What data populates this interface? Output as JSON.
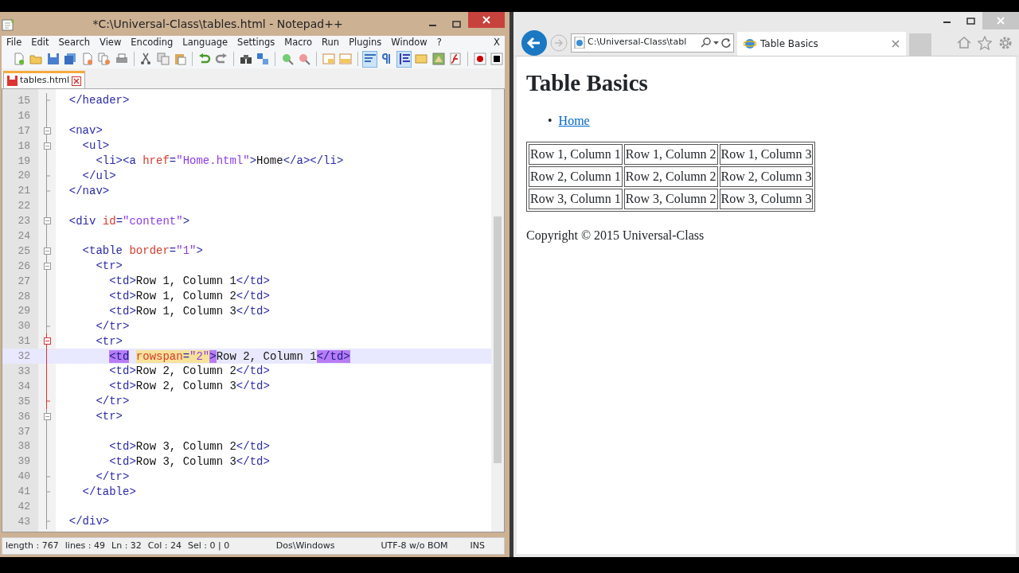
{
  "editor_window": {
    "title": "*C:\\Universal-Class\\tables.html - Notepad++",
    "menu": [
      "File",
      "Edit",
      "Search",
      "View",
      "Encoding",
      "Language",
      "Settings",
      "Macro",
      "Run",
      "Plugins",
      "Window",
      "?"
    ],
    "menu_close": "X",
    "toolbar": [
      {
        "kind": "new"
      },
      {
        "kind": "open"
      },
      {
        "kind": "save"
      },
      {
        "kind": "saveall"
      },
      {
        "kind": "close"
      },
      {
        "kind": "closeall"
      },
      {
        "kind": "print"
      },
      {
        "kind": "separator"
      },
      {
        "kind": "cut"
      },
      {
        "kind": "copy"
      },
      {
        "kind": "paste"
      },
      {
        "kind": "separator"
      },
      {
        "kind": "undo"
      },
      {
        "kind": "redo"
      },
      {
        "kind": "separator"
      },
      {
        "kind": "find"
      },
      {
        "kind": "replace"
      },
      {
        "kind": "separator"
      },
      {
        "kind": "zoomin"
      },
      {
        "kind": "zoomout"
      },
      {
        "kind": "separator"
      },
      {
        "kind": "syncv"
      },
      {
        "kind": "synch"
      },
      {
        "kind": "separator"
      },
      {
        "kind": "wrap",
        "pressed": true
      },
      {
        "kind": "allchars",
        "pressed": false
      },
      {
        "kind": "indent",
        "pressed": true
      },
      {
        "kind": "udl",
        "pressed": false
      },
      {
        "kind": "docmap",
        "pressed": false
      },
      {
        "kind": "funclist",
        "pressed": false
      },
      {
        "kind": "separator"
      },
      {
        "kind": "record"
      },
      {
        "kind": "stop"
      }
    ],
    "tabs": [
      {
        "label": "tables.html",
        "selected": true
      }
    ],
    "lines": [
      {
        "number": "15",
        "kind": "fold_end",
        "text": [
          {
            "kind": "tag",
            "text": "  </header>"
          }
        ]
      },
      {
        "number": "16",
        "kind": "plain"
      },
      {
        "number": "17",
        "kind": "fold_open",
        "text": [
          {
            "kind": "tag",
            "text": "  <nav>"
          }
        ]
      },
      {
        "number": "18",
        "kind": "fold_open",
        "text": [
          {
            "kind": "tag",
            "text": "    <ul>"
          }
        ]
      },
      {
        "number": "19",
        "kind": "plain",
        "text": [
          {
            "kind": "tag",
            "text": "      <li><a "
          },
          {
            "kind": "attr",
            "text": "href"
          },
          {
            "kind": "tag",
            "text": "="
          },
          {
            "kind": "value",
            "text": "\"Home.html\""
          },
          {
            "kind": "tag",
            "text": ">"
          },
          {
            "kind": "plain",
            "text": "Home"
          },
          {
            "kind": "tag",
            "text": "</a></li>"
          }
        ]
      },
      {
        "number": "20",
        "kind": "fold_end",
        "text": [
          {
            "kind": "tag",
            "text": "    </ul>"
          }
        ]
      },
      {
        "number": "21",
        "kind": "fold_end",
        "text": [
          {
            "kind": "tag",
            "text": "  </nav>"
          }
        ]
      },
      {
        "number": "22",
        "kind": "plain"
      },
      {
        "number": "23",
        "kind": "fold_open",
        "text": [
          {
            "kind": "tag",
            "text": "  <div "
          },
          {
            "kind": "attr",
            "text": "id"
          },
          {
            "kind": "tag",
            "text": "="
          },
          {
            "kind": "value",
            "text": "\"content\""
          },
          {
            "kind": "tag",
            "text": ">"
          }
        ]
      },
      {
        "number": "24",
        "kind": "plain"
      },
      {
        "number": "25",
        "kind": "fold_open",
        "text": [
          {
            "kind": "tag",
            "text": "    <table "
          },
          {
            "kind": "attr",
            "text": "border"
          },
          {
            "kind": "tag",
            "text": "="
          },
          {
            "kind": "value",
            "text": "\"1\""
          },
          {
            "kind": "tag",
            "text": ">"
          }
        ]
      },
      {
        "number": "26",
        "kind": "fold_open",
        "text": [
          {
            "kind": "tag",
            "text": "      <tr>"
          }
        ]
      },
      {
        "number": "27",
        "kind": "plain",
        "text": [
          {
            "kind": "tag",
            "text": "        <td>"
          },
          {
            "kind": "plain",
            "text": "Row 1, Column 1"
          },
          {
            "kind": "tag",
            "text": "</td>"
          }
        ]
      },
      {
        "number": "28",
        "kind": "plain",
        "text": [
          {
            "kind": "tag",
            "text": "        <td>"
          },
          {
            "kind": "plain",
            "text": "Row 1, Column 2"
          },
          {
            "kind": "tag",
            "text": "</td>"
          }
        ]
      },
      {
        "number": "29",
        "kind": "plain",
        "text": [
          {
            "kind": "tag",
            "text": "        <td>"
          },
          {
            "kind": "plain",
            "text": "Row 1, Column 3"
          },
          {
            "kind": "tag",
            "text": "</td>"
          }
        ]
      },
      {
        "number": "30",
        "kind": "fold_end",
        "text": [
          {
            "kind": "tag",
            "text": "      </tr>"
          }
        ]
      },
      {
        "number": "31",
        "kind": "fold_open",
        "current_block": true,
        "text": [
          {
            "kind": "tag",
            "text": "      <tr>"
          }
        ]
      },
      {
        "number": "32",
        "kind": "plain",
        "current_block": true,
        "selected": true,
        "text": [
          {
            "kind": "tag",
            "text": "        <td",
            "brace_match": true
          },
          {
            "kind": "attr",
            "text": " rowspan",
            "smart_highlight": true
          },
          {
            "kind": "tag",
            "text": "=",
            "smart_highlight": true
          },
          {
            "kind": "value",
            "text": "\"2\"",
            "smart_highlight": true
          },
          {
            "kind": "tag",
            "text": ">",
            "brace_match": true
          },
          {
            "kind": "plain",
            "text": "Row 2, Column 1"
          },
          {
            "kind": "tag",
            "text": "</td>",
            "brace_match": true
          }
        ]
      },
      {
        "number": "33",
        "kind": "plain",
        "current_block": true,
        "text": [
          {
            "kind": "tag",
            "text": "        <td>"
          },
          {
            "kind": "plain",
            "text": "Row 2, Column 2"
          },
          {
            "kind": "tag",
            "text": "</td>"
          }
        ]
      },
      {
        "number": "34",
        "kind": "plain",
        "current_block": true,
        "text": [
          {
            "kind": "tag",
            "text": "        <td>"
          },
          {
            "kind": "plain",
            "text": "Row 2, Column 3"
          },
          {
            "kind": "tag",
            "text": "</td>"
          }
        ]
      },
      {
        "number": "35",
        "kind": "fold_end",
        "current_block": true,
        "text": [
          {
            "kind": "tag",
            "text": "      </tr>"
          }
        ]
      },
      {
        "number": "36",
        "kind": "fold_open",
        "text": [
          {
            "kind": "tag",
            "text": "      <tr>"
          }
        ]
      },
      {
        "number": "37",
        "kind": "plain"
      },
      {
        "number": "38",
        "kind": "plain",
        "text": [
          {
            "kind": "tag",
            "text": "        <td>"
          },
          {
            "kind": "plain",
            "text": "Row 3, Column 2"
          },
          {
            "kind": "tag",
            "text": "</td>"
          }
        ]
      },
      {
        "number": "39",
        "kind": "plain",
        "text": [
          {
            "kind": "tag",
            "text": "        <td>"
          },
          {
            "kind": "plain",
            "text": "Row 3, Column 3"
          },
          {
            "kind": "tag",
            "text": "</td>"
          }
        ]
      },
      {
        "number": "40",
        "kind": "fold_end",
        "text": [
          {
            "kind": "tag",
            "text": "      </tr>"
          }
        ]
      },
      {
        "number": "41",
        "kind": "fold_end",
        "text": [
          {
            "kind": "tag",
            "text": "    </table>"
          }
        ]
      },
      {
        "number": "42",
        "kind": "plain"
      },
      {
        "number": "43",
        "kind": "fold_end",
        "text": [
          {
            "kind": "tag",
            "text": "  </div>"
          }
        ]
      }
    ],
    "status_bar": [
      "length : 767",
      "lines : 49",
      "Ln : 32",
      "Col : 24",
      "Sel : 0 | 0",
      "Dos\\Windows",
      "UTF-8 w/o BOM",
      "INS"
    ]
  },
  "browser_window": {
    "address": "C:\\Universal-Class\\tabl",
    "tabs": [
      {
        "label": "Table Basics",
        "selected": true
      }
    ],
    "page": {
      "heading": "Table Basics",
      "nav_links": [
        {
          "bullet": "•",
          "label": "Home"
        }
      ],
      "table": [
        [
          "Row 1, Column 1",
          "Row 1, Column 2",
          "Row 1, Column 3"
        ],
        [
          "Row 2, Column 1",
          "Row 2, Column 2",
          "Row 2, Column 3"
        ],
        [
          "Row 3, Column 1",
          "Row 3, Column 2",
          "Row 3, Column 3"
        ]
      ],
      "footer": "Copyright © 2015 Universal-Class"
    }
  }
}
